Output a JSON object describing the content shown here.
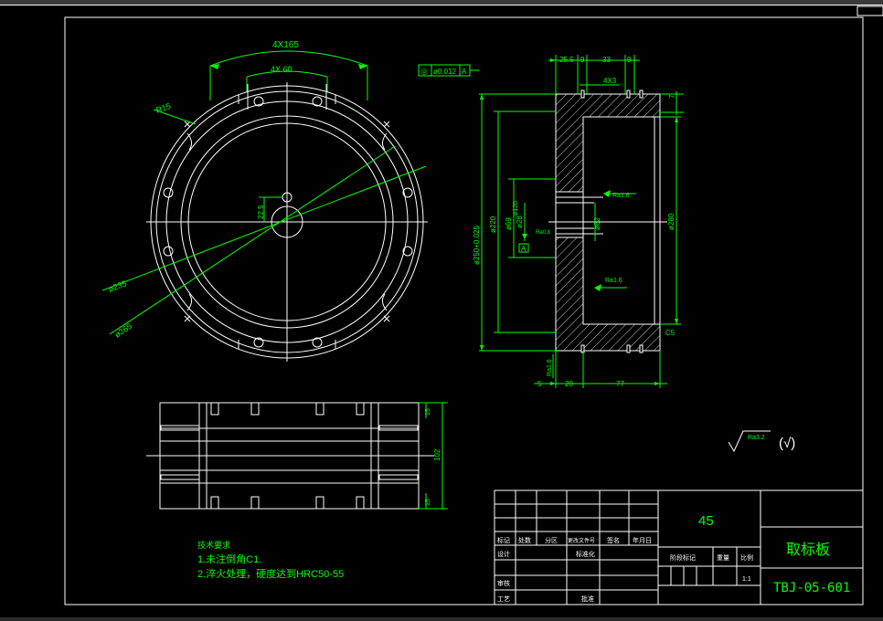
{
  "drawing": {
    "colors": {
      "background": "#000000",
      "outline": "#ffffff",
      "dimension": "#00ff00",
      "frame": "#ffffff"
    },
    "front_view": {
      "dims": {
        "arc_outer": "4X165",
        "arc_inner": "4X 60",
        "radius": "R15",
        "bolt_circle": "ø235",
        "outer_dia": "ø265",
        "hole_offset": "22.5"
      }
    },
    "section_view": {
      "tolerance_frame": {
        "symbol": "◎",
        "value": "ø0.012",
        "datum": "A"
      },
      "top_dims": [
        "25.5",
        "9",
        "33",
        "9"
      ],
      "slot_dim": "4X3",
      "right_top": "7",
      "left_dims": [
        "ø250+0.025",
        "ø220",
        "ø69",
        "ø28"
      ],
      "inner_left": "ø120",
      "center_dim": "ø62",
      "right_dim": "ø280",
      "datum_label": "A",
      "ra_center": "Ra1.6",
      "ra_face": "Ra1.6",
      "ra_small": "Ra0.8",
      "ra_bottom": "Ra1.6",
      "chamfer": "C5",
      "bottom_dims": [
        "5",
        "20",
        "77"
      ]
    },
    "side_view": {
      "height": "102",
      "step": "15"
    },
    "roughness_note": {
      "value": "Ra3.2",
      "suffix": "(√)"
    }
  },
  "notes": {
    "heading": "技术要求",
    "items": [
      "1.未注倒角C1.",
      "2.淬火处理，硬度达到HRC50-55"
    ]
  },
  "title_block": {
    "material": "45",
    "name": "取标板",
    "code": "TBJ-05-601",
    "scale": "1:1",
    "headers": [
      "标记",
      "处数",
      "分区",
      "更改文件号",
      "签名",
      "年月日"
    ],
    "row_design": [
      "设计",
      "标准化"
    ],
    "row_check": "审核",
    "row_process": [
      "工艺",
      "批准"
    ],
    "stage_headers": [
      "阶段标记",
      "重量",
      "比例"
    ]
  }
}
